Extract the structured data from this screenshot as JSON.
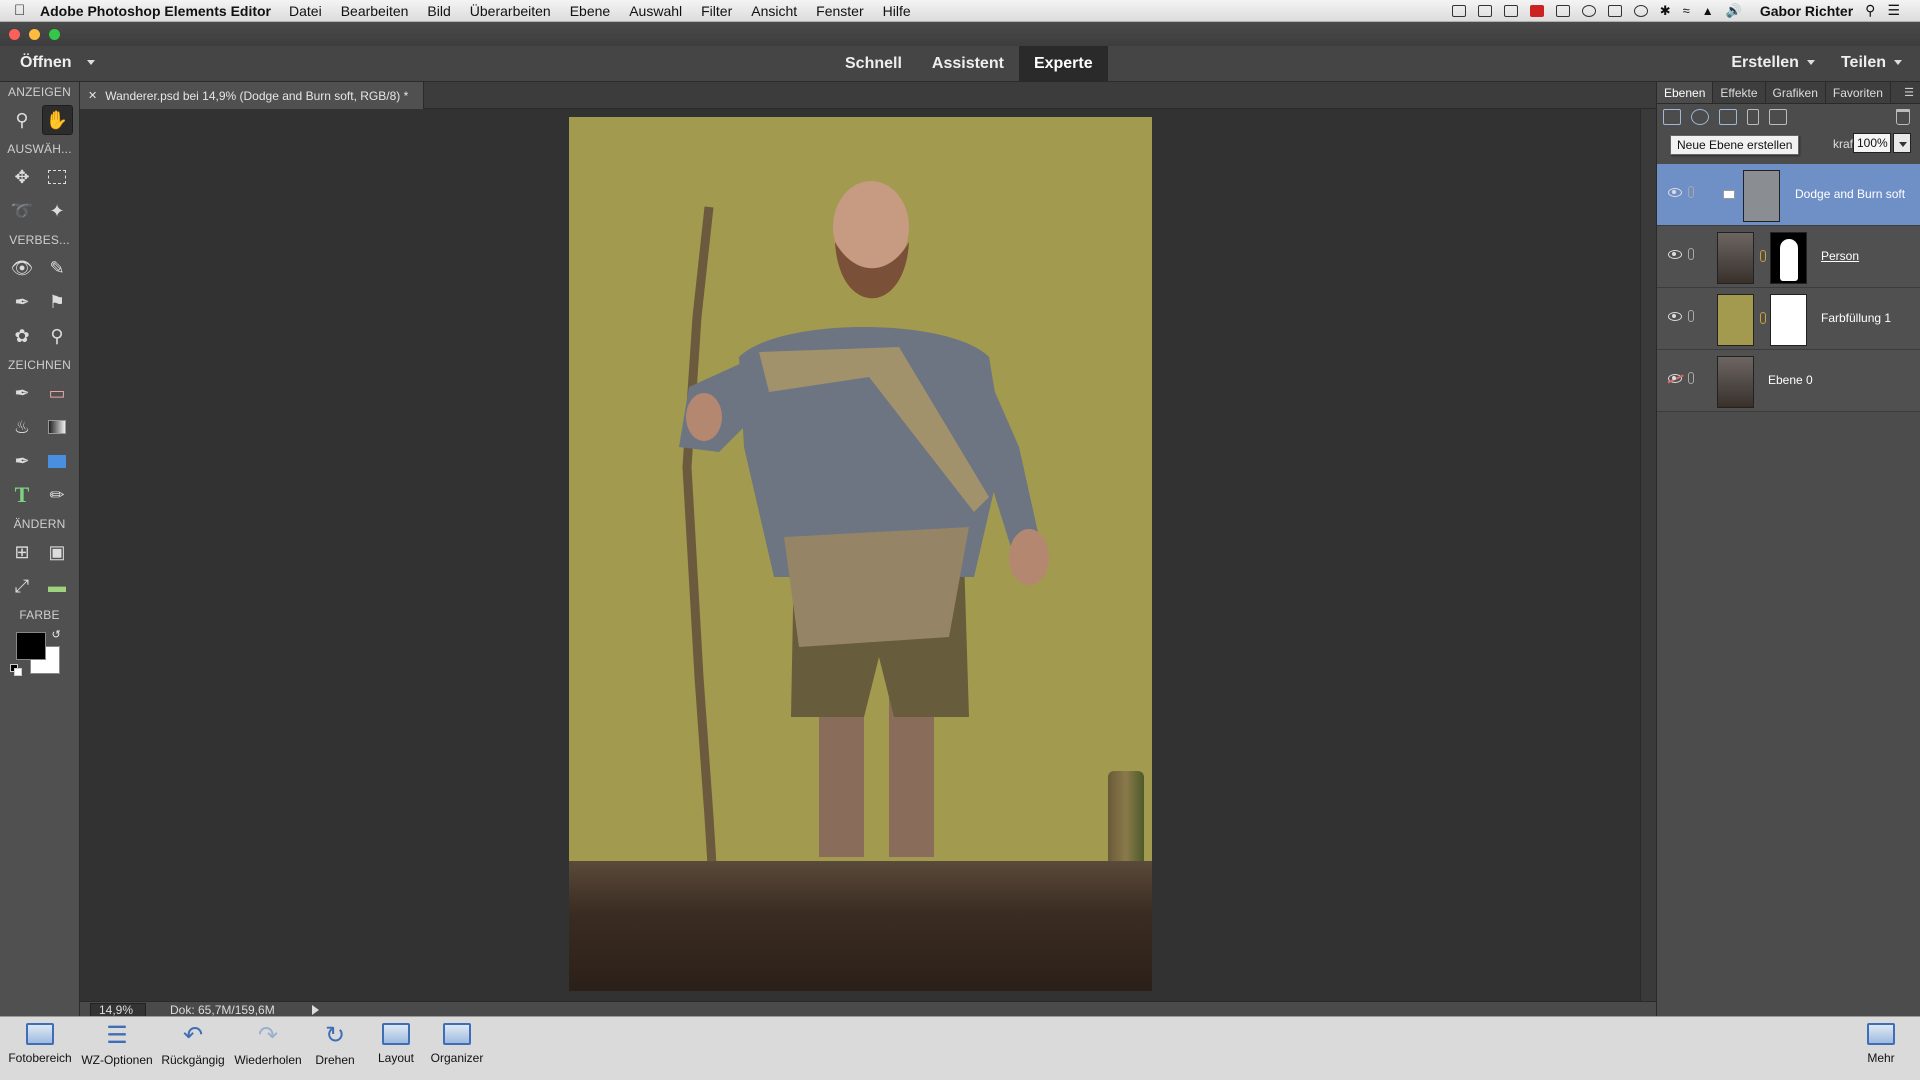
{
  "menubar": {
    "app_name": "Adobe Photoshop Elements Editor",
    "items": [
      "Datei",
      "Bearbeiten",
      "Bild",
      "Überarbeiten",
      "Ebene",
      "Auswahl",
      "Filter",
      "Ansicht",
      "Fenster",
      "Hilfe"
    ],
    "user": "Gabor Richter"
  },
  "modebar": {
    "open_label": "Öffnen",
    "modes": [
      "Schnell",
      "Assistent",
      "Experte"
    ],
    "active_mode": "Experte",
    "create_label": "Erstellen",
    "share_label": "Teilen"
  },
  "toolbox": {
    "sections": [
      "ANZEIGEN",
      "AUSWÄH...",
      "VERBES...",
      "ZEICHNEN",
      "ÄNDERN",
      "FARBE"
    ],
    "foreground_color": "#000000",
    "background_color": "#ffffff"
  },
  "document": {
    "tab_title": "Wanderer.psd bei 14,9% (Dodge and Burn soft, RGB/8) *",
    "canvas_bg": "#a29a4e"
  },
  "status": {
    "zoom": "14,9%",
    "doc_size": "Dok: 65,7M/159,6M"
  },
  "panel": {
    "tabs": [
      "Ebenen",
      "Effekte",
      "Grafiken",
      "Favoriten"
    ],
    "active_tab": "Ebenen",
    "tooltip": "Neue Ebene erstellen",
    "opacity_label": "kraft:",
    "opacity_value": "100%",
    "layers": [
      {
        "name": "Dodge and Burn soft",
        "selected": true,
        "visible": true
      },
      {
        "name": "Person",
        "selected": false,
        "visible": true
      },
      {
        "name": "Farbfüllung 1",
        "selected": false,
        "visible": true
      },
      {
        "name": "Ebene 0",
        "selected": false,
        "visible": false
      }
    ]
  },
  "bottombar": {
    "buttons": [
      "Fotobereich",
      "WZ-Optionen",
      "Rückgängig",
      "Wiederholen",
      "Drehen",
      "Layout",
      "Organizer"
    ],
    "more_label": "Mehr"
  }
}
